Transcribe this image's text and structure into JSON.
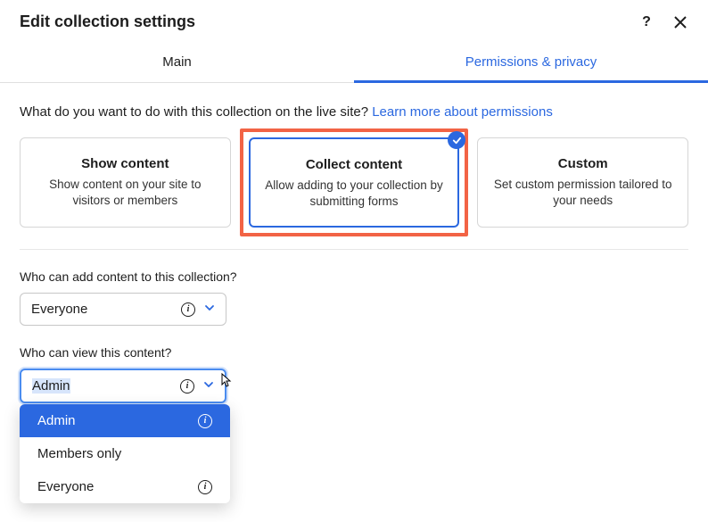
{
  "header": {
    "title": "Edit collection settings"
  },
  "tabs": {
    "main": "Main",
    "permissions": "Permissions & privacy"
  },
  "question": {
    "text": "What do you want to do with this collection on the live site? ",
    "link": "Learn more about permissions"
  },
  "cards": {
    "show": {
      "title": "Show content",
      "desc": "Show content on your site to visitors or members"
    },
    "collect": {
      "title": "Collect content",
      "desc": "Allow adding to your collection by submitting forms"
    },
    "custom": {
      "title": "Custom",
      "desc": "Set custom permission tailored to your needs"
    }
  },
  "fields": {
    "add": {
      "label": "Who can add content to this collection?",
      "value": "Everyone"
    },
    "view": {
      "label": "Who can view this content?",
      "value": "Admin",
      "options": {
        "admin": "Admin",
        "members": "Members only",
        "everyone": "Everyone"
      }
    }
  }
}
